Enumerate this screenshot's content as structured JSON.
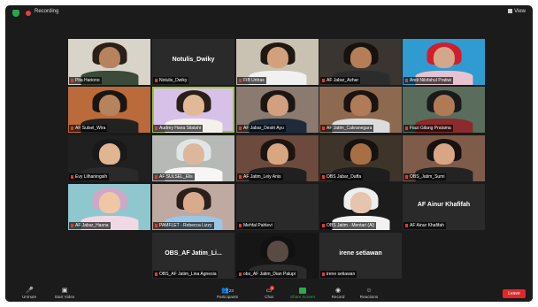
{
  "topbar": {
    "recording_label": "Recording",
    "view_label": "View"
  },
  "tiles": [
    {
      "name": "Pita Hariono",
      "video": true,
      "bg": "#d8d4c9",
      "hair": "#2b2017",
      "skin": "#b7835f",
      "shirt": "#3c4a3a"
    },
    {
      "name": "Notulis_Dwiky",
      "video": false,
      "display_name": "Notulis_Dwiky"
    },
    {
      "name": "FIB Unhas",
      "video": true,
      "bg": "#c9c2b3",
      "hair": "#1f1712",
      "skin": "#d3a07c",
      "shirt": "#f1f1f1"
    },
    {
      "name": "AF Jabar_Azhar",
      "video": true,
      "bg": "#3a3530",
      "hair": "#17120e",
      "skin": "#b57e56",
      "shirt": "#2c2c2c"
    },
    {
      "name": "Andi Nilofahul Pratiwi",
      "video": true,
      "bg": "#2f9bd1",
      "hair": "#d21d2a",
      "skin": "#d3a78b",
      "shirt": "#e9c2d0"
    },
    {
      "name": "AF Sulsel_Wira",
      "video": true,
      "bg": "#bb6a3b",
      "hair": "#1a1512",
      "skin": "#b7835a",
      "shirt": "#222"
    },
    {
      "name": "Audrey Hana Sitalahi",
      "video": true,
      "bg": "#d8c1e8",
      "hair": "#2a1e18",
      "skin": "#e1b996",
      "shirt": "#f4f0ea",
      "active": true
    },
    {
      "name": "AF Jabar_Destri Ayu",
      "video": true,
      "bg": "#8a7a70",
      "hair": "#1b1614",
      "skin": "#d2a07e",
      "shirt": "#1f2a3a"
    },
    {
      "name": "AF Jatim_Cakranegara",
      "video": true,
      "bg": "#8d6a4f",
      "hair": "#1a130f",
      "skin": "#b07b56",
      "shirt": "#dcdcdc"
    },
    {
      "name": "Fiazi Gilang Pratama",
      "video": true,
      "bg": "#5a6d5c",
      "hair": "#1a1a1a",
      "skin": "#b07a55",
      "shirt": "#8b2b2b"
    },
    {
      "name": "Evy Lilhaningsih",
      "video": true,
      "bg": "#202020",
      "hair": "#1a1818",
      "skin": "#e0b591",
      "shirt": "#2a2a2a"
    },
    {
      "name": "AF SULSEL_Elis",
      "video": true,
      "bg": "#b6b9b5",
      "hair": "#e0e6e6",
      "skin": "#ddb79c",
      "shirt": "#f6f6f6"
    },
    {
      "name": "AF Jatim_Leiy Anis",
      "video": true,
      "bg": "#6c4a3d",
      "hair": "#1c1410",
      "skin": "#d9a682",
      "shirt": "#202020"
    },
    {
      "name": "OBS Jabar_Daffa",
      "video": true,
      "bg": "#3e342a",
      "hair": "#161210",
      "skin": "#a86e44",
      "shirt": "#1e1e1e"
    },
    {
      "name": "OBS_Jatim_Sumi",
      "video": true,
      "bg": "#7f5b4a",
      "hair": "#171210",
      "skin": "#d8a684",
      "shirt": "#232323"
    },
    {
      "name": "AF Jabar_Hasna",
      "video": true,
      "bg": "#8fc7cf",
      "hair": "#cda8c8",
      "skin": "#f0c7a5",
      "shirt": "#f0d9e4"
    },
    {
      "name": "PAMFLET - Rebecca Lizzy",
      "video": true,
      "bg": "#bfa9a0",
      "hair": "#2b1f1a",
      "skin": "#d9aa8c",
      "shirt": "#9ac7e6"
    },
    {
      "name": "Mehfal Pahlevi",
      "video": false,
      "display_name": ""
    },
    {
      "name": "OBS Jatim - Mentari (Al)",
      "video": true,
      "bg": "#1c1c1c",
      "hair": "#eeeeee",
      "skin": "#e6c4ad",
      "shirt": "#f2f2f2"
    },
    {
      "name": "AF Ainur Khafifah",
      "video": false,
      "display_name": "AF Ainur Khafifah"
    },
    {
      "name": "OBS_AF Jatim_Lina Agnesia",
      "video": false,
      "display_name": "OBS_AF Jatim_Li..."
    },
    {
      "name": "obs_AF Jatim_Dian Palupi",
      "video": true,
      "bg": "#161616",
      "hair": "#111",
      "skin": "#5a4a44",
      "shirt": "#2b2b2b"
    },
    {
      "name": "irene setiawan",
      "video": false,
      "display_name": "irene setiawan"
    }
  ],
  "toolbar": {
    "unmute_label": "Unmute",
    "start_video_label": "Start Video",
    "participants_label": "Participants",
    "participants_count": "23",
    "chat_label": "Chat",
    "chat_badge": "1",
    "share_screen_label": "Share Screen",
    "record_label": "Record",
    "reactions_label": "Reactions",
    "leave_label": "Leave"
  },
  "colors": {
    "accent_green": "#9ecb2f",
    "leave_red": "#e02828",
    "share_green": "#2faa4a",
    "recording_red": "#e0433b"
  }
}
